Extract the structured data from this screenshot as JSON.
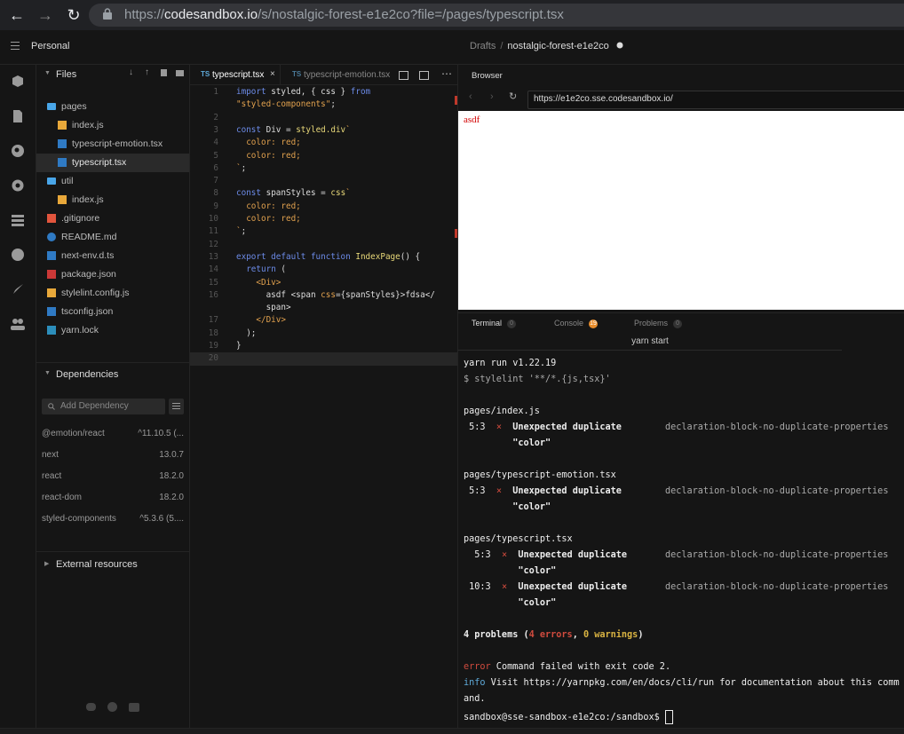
{
  "browser_chrome": {
    "url_prefix": "https://",
    "url_host": "codesandbox.io",
    "url_path": "/s/nostalgic-forest-e1e2co?file=/pages/typescript.tsx"
  },
  "header": {
    "team": "Personal",
    "drafts": "Drafts",
    "separator": "/",
    "sandbox_name": "nostalgic-forest-e1e2co"
  },
  "sidebar": {
    "files_title": "Files",
    "tree": [
      {
        "name": "pages",
        "icon": "folder-icon"
      },
      {
        "name": "index.js",
        "icon": "js-file-icon"
      },
      {
        "name": "typescript-emotion.tsx",
        "icon": "ts-file-icon"
      },
      {
        "name": "typescript.tsx",
        "icon": "ts-file-icon"
      },
      {
        "name": "util",
        "icon": "folder-icon"
      },
      {
        "name": "index.js",
        "icon": "js-file-icon"
      },
      {
        "name": ".gitignore",
        "icon": "git-icon"
      },
      {
        "name": "README.md",
        "icon": "info-icon"
      },
      {
        "name": "next-env.d.ts",
        "icon": "ts-file-icon"
      },
      {
        "name": "package.json",
        "icon": "npm-icon"
      },
      {
        "name": "stylelint.config.js",
        "icon": "js-file-icon"
      },
      {
        "name": "tsconfig.json",
        "icon": "ts-file-icon"
      },
      {
        "name": "yarn.lock",
        "icon": "yarn-icon"
      }
    ],
    "dependencies_title": "Dependencies",
    "add_dependency_placeholder": "Add Dependency",
    "dependencies": [
      {
        "name": "@emotion/react",
        "version": "^11.10.5 (..."
      },
      {
        "name": "next",
        "version": "13.0.7"
      },
      {
        "name": "react",
        "version": "18.2.0"
      },
      {
        "name": "react-dom",
        "version": "18.2.0"
      },
      {
        "name": "styled-components",
        "version": "^5.3.6 (5...."
      }
    ],
    "external_title": "External resources"
  },
  "editor": {
    "tabs": [
      {
        "label": "typescript.tsx",
        "active": true
      },
      {
        "label": "typescript-emotion.tsx",
        "active": false
      }
    ],
    "lines": [
      {
        "n": "1",
        "html": "<span class=\"kw\">import</span> styled, { css } <span class=\"kw\">from</span>"
      },
      {
        "n": "",
        "html": "<span class=\"str\">\"styled-components\"</span>;"
      },
      {
        "n": "2",
        "html": ""
      },
      {
        "n": "3",
        "html": "<span class=\"kw\">const</span> Div = <span class=\"fn\">styled.div</span><span class=\"str\">`</span>"
      },
      {
        "n": "4",
        "html": "<span class=\"str\">  color: red;</span>"
      },
      {
        "n": "5",
        "html": "<span class=\"str\">  color: red;</span>"
      },
      {
        "n": "6",
        "html": "<span class=\"str\">`</span>;"
      },
      {
        "n": "7",
        "html": ""
      },
      {
        "n": "8",
        "html": "<span class=\"kw\">const</span> spanStyles = <span class=\"fn\">css</span><span class=\"str\">`</span>"
      },
      {
        "n": "9",
        "html": "<span class=\"str\">  color: red;</span>"
      },
      {
        "n": "10",
        "html": "<span class=\"str\">  color: red;</span>"
      },
      {
        "n": "11",
        "html": "<span class=\"str\">`</span>;"
      },
      {
        "n": "12",
        "html": ""
      },
      {
        "n": "13",
        "html": "<span class=\"kw\">export default function</span> <span class=\"fn\">IndexPage</span>() {"
      },
      {
        "n": "14",
        "html": "  <span class=\"kw\">return</span> ("
      },
      {
        "n": "15",
        "html": "    <span class=\"tag\">&lt;Div&gt;</span>"
      },
      {
        "n": "16",
        "html": "      asdf &lt;span <span class=\"str\">css</span>={spanStyles}&gt;fdsa&lt;/"
      },
      {
        "n": "",
        "html": "      span&gt;"
      },
      {
        "n": "17",
        "html": "    <span class=\"tag\">&lt;/Div&gt;</span>"
      },
      {
        "n": "18",
        "html": "  );"
      },
      {
        "n": "19",
        "html": "}"
      },
      {
        "n": "20",
        "html": ""
      }
    ]
  },
  "browser": {
    "title": "Browser",
    "address": "https://e1e2co.sse.codesandbox.io/",
    "page_text": "asdf"
  },
  "terminal": {
    "tabs": [
      {
        "label": "Terminal",
        "badge": "0"
      },
      {
        "label": "Console",
        "badge": "19"
      },
      {
        "label": "Problems",
        "badge": "0"
      }
    ],
    "task": "yarn start",
    "lines": [
      {
        "html": "yarn run v1.22.19"
      },
      {
        "html": "<span class=\"dim\">$ stylelint '**/*.{js,tsx}'</span>"
      },
      {
        "html": ""
      },
      {
        "html": "pages/index.js"
      },
      {
        "html": " 5:3  <span class=\"e\">×</span>  <b>Unexpected duplicate</b>        <span class=\"dim\">declaration-block-no-duplicate-properties</span>"
      },
      {
        "html": "         <b>\"color\"</b>"
      },
      {
        "html": ""
      },
      {
        "html": "pages/typescript-emotion.tsx"
      },
      {
        "html": " 5:3  <span class=\"e\">×</span>  <b>Unexpected duplicate</b>        <span class=\"dim\">declaration-block-no-duplicate-properties</span>"
      },
      {
        "html": "         <b>\"color\"</b>"
      },
      {
        "html": ""
      },
      {
        "html": "pages/typescript.tsx"
      },
      {
        "html": "  5:3  <span class=\"e\">×</span>  <b>Unexpected duplicate</b>       <span class=\"dim\">declaration-block-no-duplicate-properties</span>"
      },
      {
        "html": "          <b>\"color\"</b>"
      },
      {
        "html": " 10:3  <span class=\"e\">×</span>  <b>Unexpected duplicate</b>       <span class=\"dim\">declaration-block-no-duplicate-properties</span>"
      },
      {
        "html": "          <b>\"color\"</b>"
      },
      {
        "html": ""
      },
      {
        "html": "<b>4 problems (<span class=\"e\">4 errors</span>, <span class=\"w\">0 warnings</span>)</b>"
      },
      {
        "html": ""
      },
      {
        "html": "<span class=\"e\">error</span> Command failed with exit code 2."
      },
      {
        "html": "<span class=\"i\">info</span> Visit https://yarnpkg.com/en/docs/cli/run for documentation about this comm"
      },
      {
        "html": "and."
      },
      {
        "html": "sandbox@sse-sandbox-e1e2co:/sandbox$ <span style=\"display:inline-block;width:7px;height:14px;border:1px solid #eee;vertical-align:middle;\"></span>"
      }
    ]
  }
}
